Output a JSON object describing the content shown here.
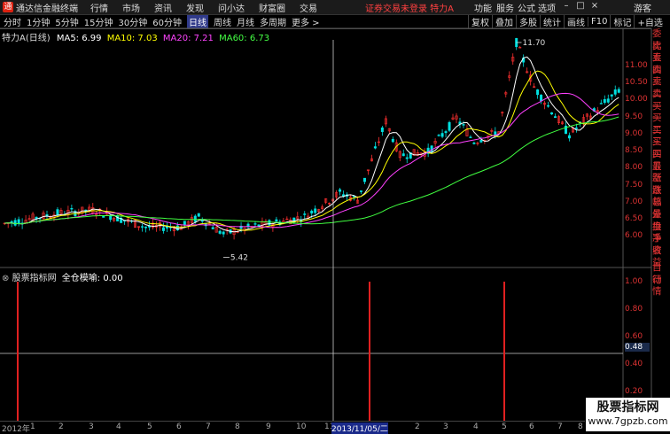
{
  "app": {
    "title": "通达信金融终端",
    "logo": "通"
  },
  "menu": [
    "行情",
    "市场",
    "资讯",
    "发现",
    "问小达",
    "财富圈",
    "交易"
  ],
  "warning": "证券交易未登录 特力A",
  "right_menu": [
    "功能",
    "服务",
    "公式",
    "选项",
    "游客"
  ],
  "toolbar": {
    "timeframes": [
      "分时",
      "1分钟",
      "5分钟",
      "15分钟",
      "30分钟",
      "60分钟",
      "日线",
      "周线",
      "月线",
      "多周期",
      "更多 >"
    ],
    "active": "日线",
    "right_buttons": [
      "复权",
      "叠加",
      "多股",
      "统计",
      "画线",
      "F10",
      "标记",
      "+自选"
    ]
  },
  "main": {
    "stock": "特力A(日线)",
    "ma": [
      {
        "label": "MA5: 6.99",
        "color": "#ffffff"
      },
      {
        "label": "MA10: 7.03",
        "color": "#ffff00"
      },
      {
        "label": "MA20: 7.21",
        "color": "#ff40ff"
      },
      {
        "label": "MA60: 6.73",
        "color": "#40ff40"
      }
    ],
    "yticks": [
      "11.00",
      "10.50",
      "10.00",
      "9.50",
      "9.00",
      "8.50",
      "8.00",
      "7.50",
      "7.00",
      "6.50",
      "6.00"
    ],
    "high_label": "11.70",
    "low_label": "5.42"
  },
  "indicator": {
    "name": "股票指标网",
    "label": "全仓模喻: 0.00",
    "yticks": [
      "1.00",
      "0.80",
      "0.60",
      "0.40",
      "0.20"
    ],
    "cursor_value": "0.48"
  },
  "side_panel": [
    "委比",
    "卖五",
    "卖四",
    "卖三",
    "卖二",
    "卖一",
    "买一",
    "买二",
    "买三",
    "买四",
    "买五",
    "最新",
    "涨跌",
    "涨幅",
    "总量",
    "外盘",
    "换手",
    "净资",
    "收益",
    "自动",
    "行情"
  ],
  "bottom_axis": {
    "labels": [
      "2012年",
      "1",
      "2",
      "3",
      "4",
      "5",
      "6",
      "7",
      "8",
      "9",
      "10",
      "11",
      "2013/11/05/二",
      "2",
      "3",
      "4",
      "5",
      "6",
      "7",
      "8"
    ],
    "cursor": "2013/11/05/二"
  },
  "watermark": {
    "line1": "股票指标网",
    "line2": "www.7gpzb.com"
  },
  "colors": {
    "up": "#ff3030",
    "down": "#00e0e0",
    "ma5": "#ffffff",
    "ma10": "#ffff00",
    "ma20": "#ff40ff",
    "ma60": "#40ff40"
  }
}
